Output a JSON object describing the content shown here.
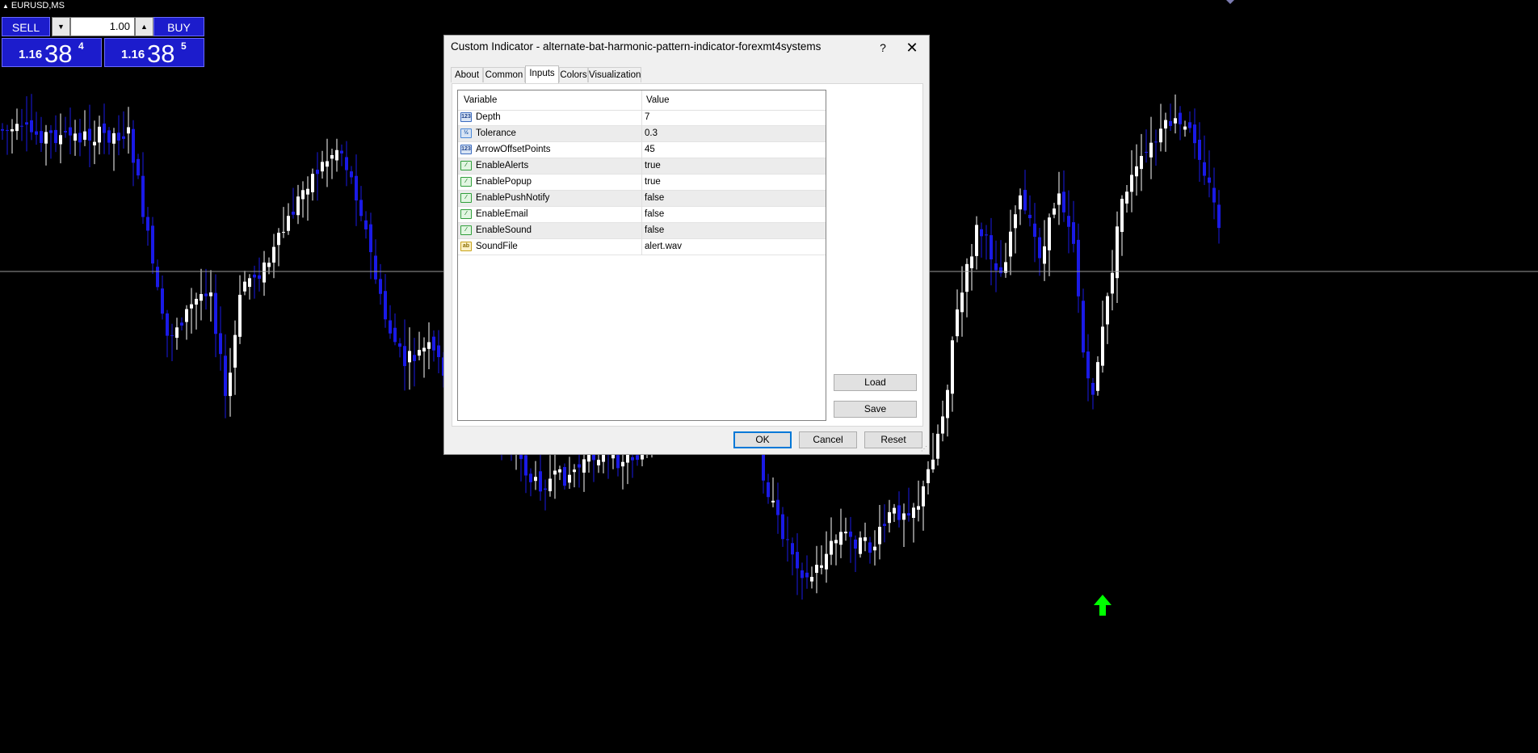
{
  "chart": {
    "symbol": "EURUSD,MS",
    "up_arrow_color": "#00ff00",
    "bull_color": "#ffffff",
    "bear_color": "#1a1ae6",
    "background": "#000000"
  },
  "trade_panel": {
    "sell_label": "SELL",
    "buy_label": "BUY",
    "lot_value": "1.00",
    "bid": {
      "big": "1.16",
      "pips": "38",
      "point": "4"
    },
    "ask": {
      "big": "1.16",
      "pips": "38",
      "point": "5"
    }
  },
  "dialog": {
    "title": "Custom Indicator - alternate-bat-harmonic-pattern-indicator-forexmt4systems",
    "help_glyph": "?",
    "close_glyph": "✕",
    "tabs": [
      {
        "label": "About"
      },
      {
        "label": "Common"
      },
      {
        "label": "Inputs"
      },
      {
        "label": "Colors"
      },
      {
        "label": "Visualization"
      }
    ],
    "active_tab": "Inputs",
    "columns": {
      "variable": "Variable",
      "value": "Value"
    },
    "inputs": [
      {
        "icon": "int-icon",
        "icon_text": "123",
        "name": "Depth",
        "value": "7"
      },
      {
        "icon": "double-icon",
        "icon_text": "½",
        "name": "Tolerance",
        "value": "0.3"
      },
      {
        "icon": "int-icon",
        "icon_text": "123",
        "name": "ArrowOffsetPoints",
        "value": "45"
      },
      {
        "icon": "bool-icon",
        "icon_text": "⁄",
        "name": "EnableAlerts",
        "value": "true"
      },
      {
        "icon": "bool-icon",
        "icon_text": "⁄",
        "name": "EnablePopup",
        "value": "true"
      },
      {
        "icon": "bool-icon",
        "icon_text": "⁄",
        "name": "EnablePushNotify",
        "value": "false"
      },
      {
        "icon": "bool-icon",
        "icon_text": "⁄",
        "name": "EnableEmail",
        "value": "false"
      },
      {
        "icon": "bool-icon",
        "icon_text": "⁄",
        "name": "EnableSound",
        "value": "false"
      },
      {
        "icon": "string-icon",
        "icon_text": "ab",
        "name": "SoundFile",
        "value": "alert.wav"
      }
    ],
    "load_label": "Load",
    "save_label": "Save",
    "ok_label": "OK",
    "cancel_label": "Cancel",
    "reset_label": "Reset"
  }
}
